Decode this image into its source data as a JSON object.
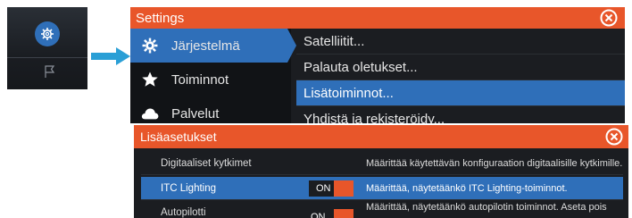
{
  "settings": {
    "title": "Settings",
    "categories": [
      {
        "label": "Järjestelmä",
        "icon": "gear-icon"
      },
      {
        "label": "Toiminnot",
        "icon": "star-icon"
      },
      {
        "label": "Palvelut",
        "icon": "cloud-icon"
      }
    ],
    "options": [
      {
        "label": "Satelliitit..."
      },
      {
        "label": "Palauta oletukset..."
      },
      {
        "label": "Lisätoiminnot..."
      },
      {
        "label": "Yhdistä ja rekisteröidy..."
      }
    ]
  },
  "advanced": {
    "title": "Lisäasetukset",
    "rows": [
      {
        "name": "Digitaaliset kytkimet",
        "value": "",
        "description": "Määrittää käytettävän konfiguraation digitaalisille kytkimille."
      },
      {
        "name": "ITC Lighting",
        "value": "ON",
        "description": "Määrittää, näytetäänkö ITC Lighting-toiminnot."
      },
      {
        "name": "Autopilotti",
        "value": "ON",
        "description": "Määrittää, näytetäänkö autopilotin toiminnot. Aseta pois"
      }
    ]
  },
  "colors": {
    "accent": "#e8562a",
    "selection": "#2f6fb9",
    "panel": "#1b1d21"
  }
}
